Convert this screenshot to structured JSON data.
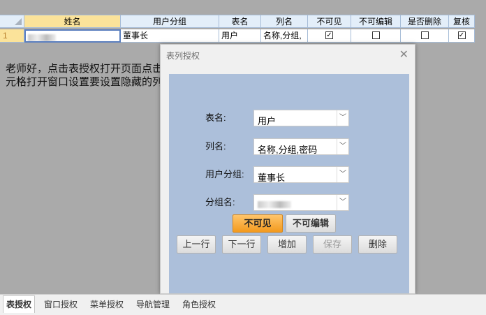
{
  "grid": {
    "columns": [
      "姓名",
      "用户分组",
      "表名",
      "列名",
      "不可见",
      "不可编辑",
      "是否删除",
      "复核"
    ],
    "row": {
      "number": "1",
      "name_redacted": true,
      "group": "董事长",
      "table": "用户",
      "columns_value": "名称,分组,",
      "invisible": true,
      "not_editable": false,
      "deleted": false,
      "review": true
    }
  },
  "message": "老师好，点击表授权打开页面点击单元格打开窗口设置要设置隐藏的列。",
  "dialog": {
    "title": "表列授权",
    "fields": {
      "table_label": "表名:",
      "table_value": "用户",
      "column_label": "列名:",
      "column_value": "名称,分组,密码",
      "group_label": "用户分组:",
      "group_value": "董事长",
      "groupname_label": "分组名:"
    },
    "toggles": {
      "invisible": "不可见",
      "not_editable": "不可编辑"
    },
    "buttons": {
      "prev": "上一行",
      "next": "下一行",
      "add": "增加",
      "save": "保存",
      "delete": "删除"
    }
  },
  "tabs": [
    "表授权",
    "窗口授权",
    "菜单授权",
    "导航管理",
    "角色授权"
  ],
  "active_tab": "表授权"
}
